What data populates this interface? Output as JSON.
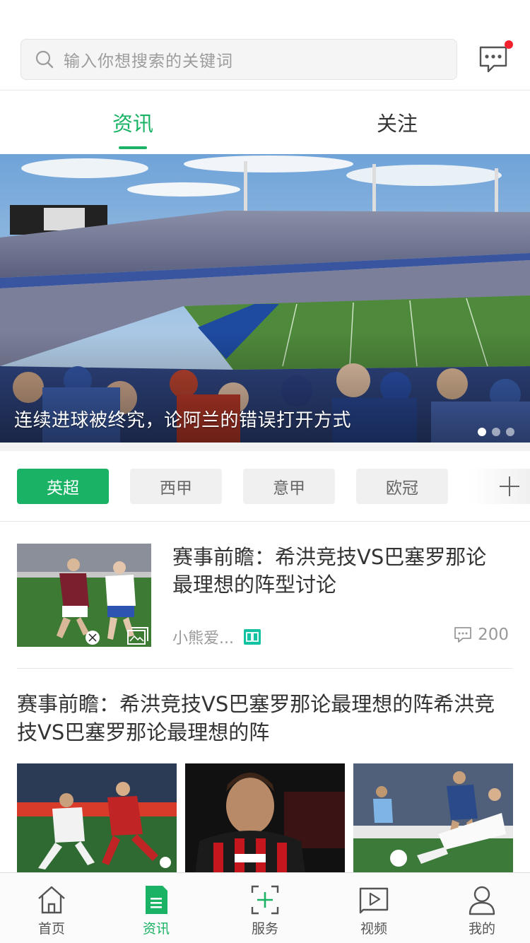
{
  "search": {
    "placeholder": "输入你想搜索的关键词",
    "icon": "search-icon"
  },
  "header": {
    "message_icon": "chat-bubble-icon",
    "has_unread": true
  },
  "tabs": [
    {
      "label": "资讯",
      "active": true
    },
    {
      "label": "关注",
      "active": false
    }
  ],
  "banner": {
    "title": "连续进球被终究，论阿兰的错误打开方式",
    "slide_count": 3,
    "active_slide": 1
  },
  "categories": [
    {
      "label": "英超",
      "active": true
    },
    {
      "label": "西甲",
      "active": false
    },
    {
      "label": "意甲",
      "active": false
    },
    {
      "label": "欧冠",
      "active": false
    }
  ],
  "add_category_icon": "plus-icon",
  "feed": {
    "article1": {
      "title": "赛事前瞻：希洪竞技VS巴塞罗那论最理想的阵型讨论",
      "author": "小熊爱...",
      "comments": "200"
    },
    "article2": {
      "title": "赛事前瞻：希洪竞技VS巴塞罗那论最理想的阵希洪竞技VS巴塞罗那论最理想的阵"
    }
  },
  "tabbar": [
    {
      "label": "首页",
      "icon": "home-icon",
      "active": false
    },
    {
      "label": "资讯",
      "icon": "news-icon",
      "active": true
    },
    {
      "label": "服务",
      "icon": "service-icon",
      "active": false
    },
    {
      "label": "视频",
      "icon": "video-icon",
      "active": false
    },
    {
      "label": "我的",
      "icon": "profile-icon",
      "active": false
    }
  ],
  "colors": {
    "accent": "#1ab365",
    "badge": "#f5222d"
  }
}
